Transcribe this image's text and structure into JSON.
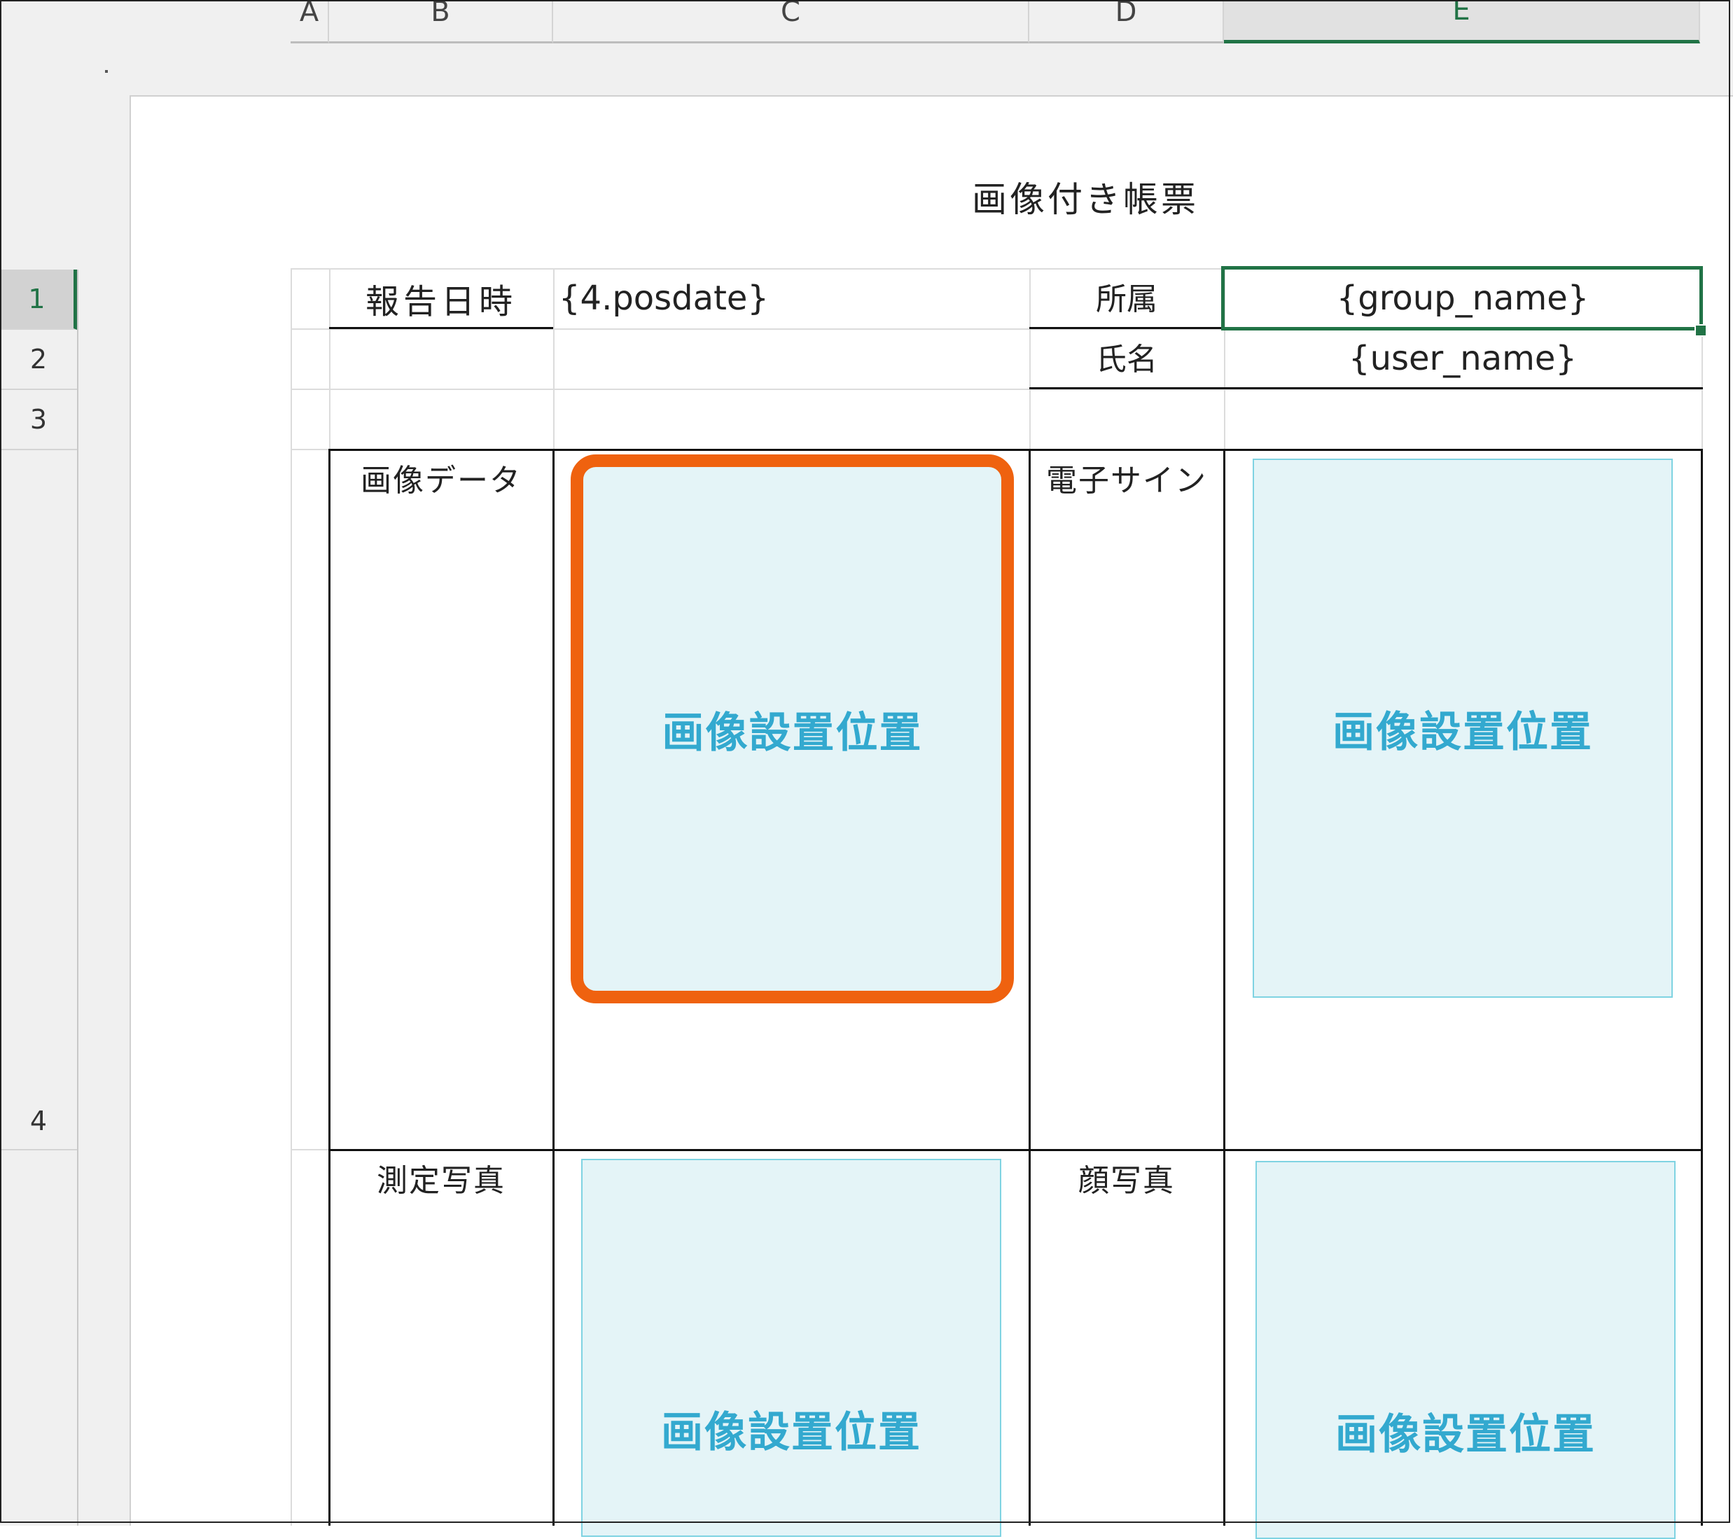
{
  "spreadsheet": {
    "columns": [
      "A",
      "B",
      "C",
      "D",
      "E"
    ],
    "active_column": "E",
    "rows": [
      "1",
      "2",
      "3",
      "4"
    ],
    "active_row": "1"
  },
  "report": {
    "title": "画像付き帳票",
    "report_date_label": "報告日時",
    "report_date_value": "{4.posdate}",
    "affiliation_label": "所属",
    "affiliation_value": "{group_name}",
    "name_label": "氏名",
    "name_value": "{user_name}",
    "image_data_label": "画像データ",
    "e_signature_label": "電子サイン",
    "measurement_photo_label": "測定写真",
    "face_photo_label": "顔写真",
    "image_placeholder": "画像設置位置"
  },
  "colors": {
    "excel_green": "#217346",
    "highlight_orange": "#ef620f",
    "placeholder_fill": "#e4f4f7",
    "placeholder_text": "#33a9cf"
  }
}
